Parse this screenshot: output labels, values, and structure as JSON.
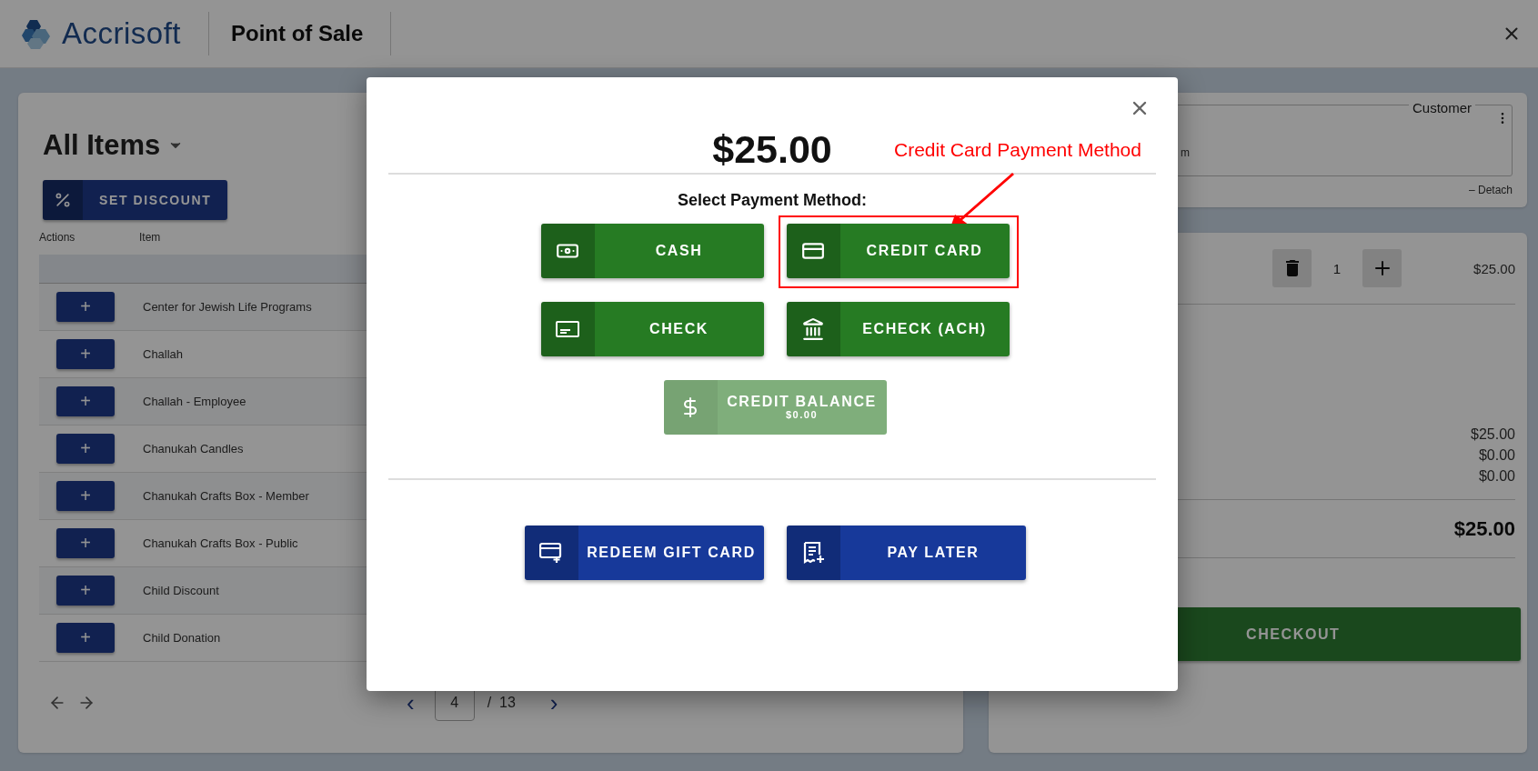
{
  "header": {
    "brand": "Accrisoft",
    "title": "Point of Sale"
  },
  "items_panel": {
    "title": "All Items",
    "discount_button": "SET DISCOUNT",
    "columns": [
      "Actions",
      "Item"
    ],
    "rows": [
      {
        "action": "+",
        "item": "Center for Jewish Life Programs"
      },
      {
        "action": "+",
        "item": "Challah"
      },
      {
        "action": "+",
        "item": "Challah - Employee"
      },
      {
        "action": "+",
        "item": "Chanukah Candles"
      },
      {
        "action": "+",
        "item": "Chanukah Crafts Box - Member"
      },
      {
        "action": "+",
        "item": "Chanukah Crafts Box - Public"
      },
      {
        "action": "+",
        "item": "Child Discount"
      },
      {
        "action": "+",
        "item": "Child Donation"
      }
    ],
    "pagination": {
      "prev": "‹",
      "page": "4",
      "total": "/  13",
      "next": "›"
    }
  },
  "customer_panel": {
    "label": "Customer",
    "value": "m",
    "detach": "– Detach"
  },
  "cart_panel": {
    "line": {
      "quantity": "1",
      "price": "$25.00"
    },
    "totals": [
      "$25.00",
      "$0.00",
      "$0.00"
    ],
    "grand_total": "$25.00",
    "checkout": "CHECKOUT"
  },
  "payment_dialog": {
    "amount": "$25.00",
    "annotation": "Credit Card Payment Method",
    "prompt": "Select Payment Method:",
    "methods": [
      {
        "kind": "cash",
        "label": "CASH",
        "disabled": false,
        "highlighted": false
      },
      {
        "kind": "card",
        "label": "CREDIT CARD",
        "disabled": false,
        "highlighted": true
      },
      {
        "kind": "check",
        "label": "CHECK",
        "disabled": false,
        "highlighted": false
      },
      {
        "kind": "bank",
        "label": "ECHECK (ACH)",
        "disabled": false,
        "highlighted": false
      },
      {
        "kind": "balance",
        "label": "CREDIT BALANCE",
        "sublabel": "$0.00",
        "disabled": true,
        "highlighted": false
      }
    ],
    "actions": [
      {
        "kind": "giftcard",
        "label": "REDEEM GIFT CARD"
      },
      {
        "kind": "paylater",
        "label": "PAY LATER"
      }
    ]
  }
}
